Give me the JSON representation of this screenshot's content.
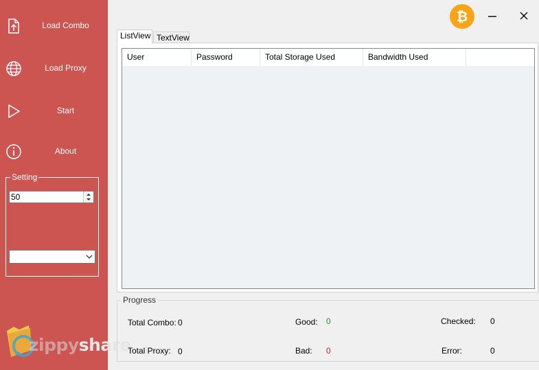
{
  "sidebar": {
    "items": [
      {
        "label": "Load Combo",
        "icon": "file-upload-icon"
      },
      {
        "label": "Load Proxy",
        "icon": "globe-icon"
      },
      {
        "label": "Start",
        "icon": "play-icon"
      },
      {
        "label": "About",
        "icon": "info-icon"
      }
    ],
    "setting": {
      "legend": "Setting",
      "threads_value": "50",
      "dropdown_value": ""
    },
    "logo": {
      "part1": "zippy",
      "part2": "share"
    }
  },
  "window": {
    "icons": {
      "bitcoin": "bitcoin-icon",
      "minimize": "minimize-icon",
      "close": "close-icon"
    },
    "bitcoin_glyph": "₿"
  },
  "tabs": [
    {
      "label": "ListView",
      "active": true
    },
    {
      "label": "TextView",
      "active": false
    }
  ],
  "table": {
    "columns": [
      "User",
      "Password",
      "Total Storage Used",
      "Bandwidth Used"
    ],
    "rows": []
  },
  "progress": {
    "legend": "Progress",
    "total_combo_label": "Total Combo:",
    "total_combo_value": "0",
    "total_proxy_label": "Total Proxy:",
    "total_proxy_value": "0",
    "good_label": "Good:",
    "good_value": "0",
    "bad_label": "Bad:",
    "bad_value": "0",
    "checked_label": "Checked:",
    "checked_value": "0",
    "error_label": "Error:",
    "error_value": "0"
  },
  "colors": {
    "sidebar_bg": "#cc5451",
    "bitcoin": "#f7a416",
    "good": "#159c2a",
    "bad": "#e02020"
  }
}
